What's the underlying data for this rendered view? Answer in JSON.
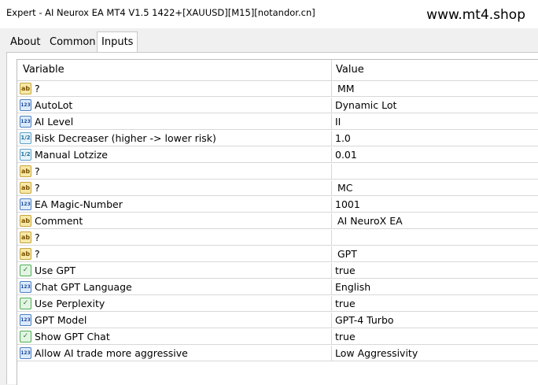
{
  "window": {
    "title": "Expert - AI Neurox EA MT4  V1.5 1422+[XAUUSD][M15][notandor.cn]",
    "watermark": "www.mt4.shop"
  },
  "tabs": [
    {
      "label": "About",
      "active": false
    },
    {
      "label": "Common",
      "active": false
    },
    {
      "label": "Inputs",
      "active": true
    }
  ],
  "table": {
    "headers": {
      "variable": "Variable",
      "value": "Value"
    },
    "rows": [
      {
        "type": "ab",
        "icon": "string-type-icon",
        "variable": "?",
        "value": "MM"
      },
      {
        "type": "num",
        "icon": "integer-type-icon",
        "variable": "AutoLot",
        "value": "Dynamic Lot"
      },
      {
        "type": "num",
        "icon": "integer-type-icon",
        "variable": "AI Level",
        "value": "II"
      },
      {
        "type": "dbl",
        "icon": "double-type-icon",
        "variable": "Risk Decreaser (higher -> lower risk)",
        "value": "1.0"
      },
      {
        "type": "dbl",
        "icon": "double-type-icon",
        "variable": "Manual Lotzize",
        "value": "0.01"
      },
      {
        "type": "ab",
        "icon": "string-type-icon",
        "variable": "?",
        "value": ""
      },
      {
        "type": "ab",
        "icon": "string-type-icon",
        "variable": "?",
        "value": "MC"
      },
      {
        "type": "num",
        "icon": "integer-type-icon",
        "variable": "EA Magic-Number",
        "value": "1001"
      },
      {
        "type": "ab",
        "icon": "string-type-icon",
        "variable": "Comment",
        "value": "AI NeuroX EA"
      },
      {
        "type": "ab",
        "icon": "string-type-icon",
        "variable": "?",
        "value": ""
      },
      {
        "type": "ab",
        "icon": "string-type-icon",
        "variable": "?",
        "value": "GPT"
      },
      {
        "type": "bool",
        "icon": "bool-type-icon",
        "variable": "Use GPT",
        "value": "true"
      },
      {
        "type": "num",
        "icon": "integer-type-icon",
        "variable": "Chat GPT Language",
        "value": "English"
      },
      {
        "type": "bool",
        "icon": "bool-type-icon",
        "variable": "Use Perplexity",
        "value": "true"
      },
      {
        "type": "num",
        "icon": "integer-type-icon",
        "variable": "GPT Model",
        "value": "GPT-4 Turbo"
      },
      {
        "type": "bool",
        "icon": "bool-type-icon",
        "variable": "Show GPT Chat",
        "value": "true"
      },
      {
        "type": "num",
        "icon": "integer-type-icon",
        "variable": "Allow AI trade more aggressive",
        "value": "Low Aggressivity"
      }
    ]
  }
}
